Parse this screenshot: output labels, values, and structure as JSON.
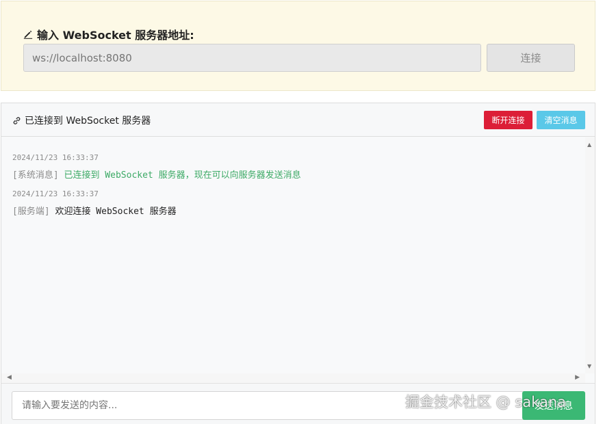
{
  "connect": {
    "title": "输入 WebSocket 服务器地址:",
    "url_placeholder": "ws://localhost:8080",
    "connect_label": "连接"
  },
  "header": {
    "status": "已连接到 WebSocket 服务器",
    "disconnect_label": "断开连接",
    "clear_label": "清空消息"
  },
  "messages": [
    {
      "time": "2024/11/23 16:33:37",
      "tag": "[系统消息]",
      "content": "已连接到 WebSocket 服务器，现在可以向服务器发送消息"
    },
    {
      "time": "2024/11/23 16:33:37",
      "tag": "[服务端]",
      "content": "欢迎连接 WebSocket 服务器"
    }
  ],
  "composer": {
    "placeholder": "请输入要发送的内容...",
    "send_label": "发送消息"
  },
  "watermark": "掘金技术社区 @ sakana",
  "icons": {
    "pencil": "pencil-icon",
    "link": "link-icon"
  },
  "colors": {
    "connect_bg": "#fdf9e6",
    "disconnect": "#dc1e37",
    "clear": "#5ac8e8",
    "send": "#3bb874",
    "system_text": "#3daa66"
  }
}
